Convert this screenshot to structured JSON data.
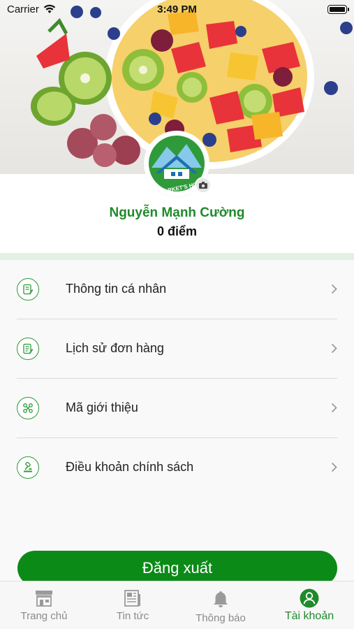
{
  "status_bar": {
    "carrier": "Carrier",
    "time": "3:49 PM"
  },
  "avatar": {
    "logo_text": "MARKET'S HO"
  },
  "profile": {
    "name": "Nguyễn Mạnh Cường",
    "points": "0 điểm"
  },
  "menu": {
    "items": [
      {
        "label": "Thông tin cá nhân",
        "icon": "edit-document-icon"
      },
      {
        "label": "Lịch sử đơn hàng",
        "icon": "order-history-icon"
      },
      {
        "label": "Mã giới thiệu",
        "icon": "referral-code-icon"
      },
      {
        "label": "Điều khoản chính sách",
        "icon": "policy-gavel-icon"
      }
    ]
  },
  "logout": {
    "label": "Đăng xuất"
  },
  "tabbar": {
    "tabs": [
      {
        "label": "Trang chủ",
        "icon": "store-icon",
        "active": false
      },
      {
        "label": "Tin tức",
        "icon": "newspaper-icon",
        "active": false
      },
      {
        "label": "Thông báo",
        "icon": "bell-icon",
        "active": false
      },
      {
        "label": "Tài khoản",
        "icon": "account-icon",
        "active": true
      }
    ]
  },
  "colors": {
    "brand_green": "#1f8a2b",
    "button_green": "#0c8a17",
    "inactive_gray": "#8a8a8a"
  }
}
